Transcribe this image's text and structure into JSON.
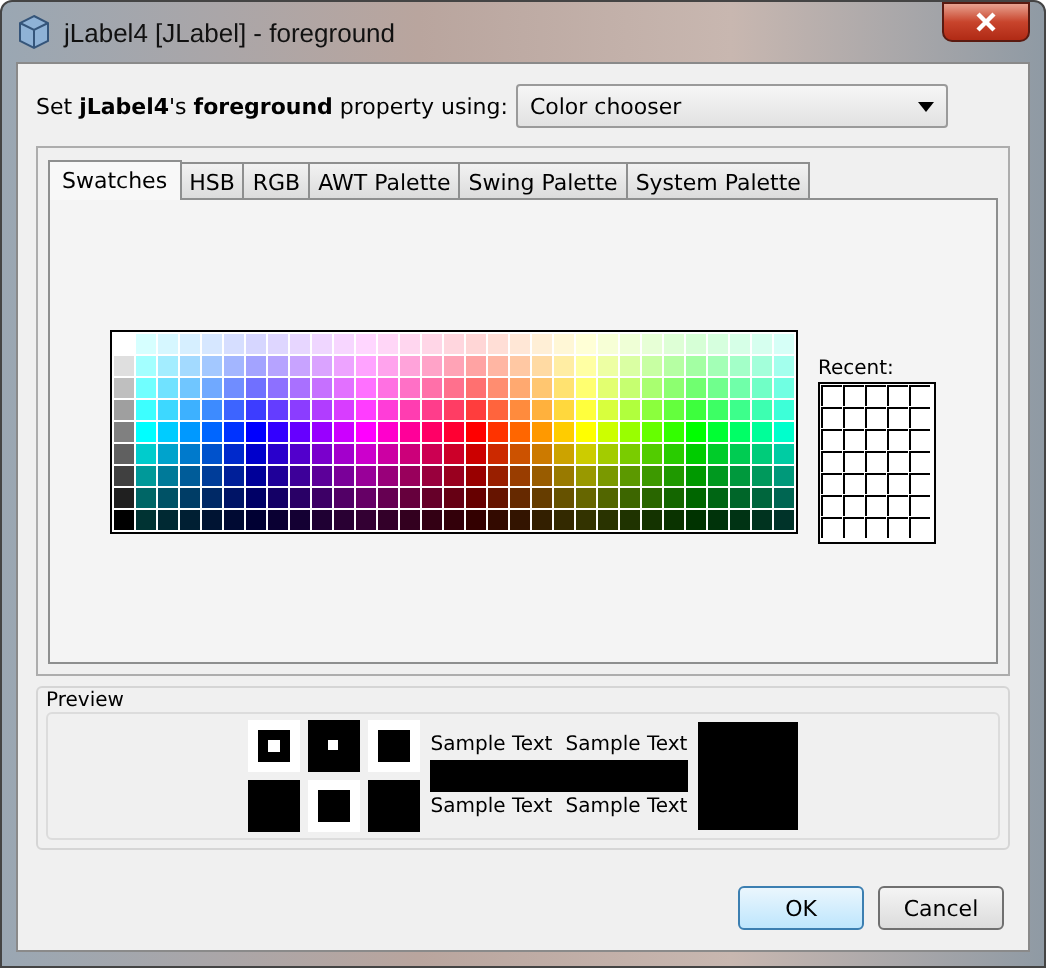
{
  "window": {
    "title": "jLabel4 [JLabel] - foreground"
  },
  "property_prompt": "Set **jLabel4**'s **foreground** property using:",
  "editor_dropdown": {
    "value": "Color chooser"
  },
  "tabs": [
    {
      "label": "Swatches",
      "selected": true
    },
    {
      "label": "HSB",
      "selected": false
    },
    {
      "label": "RGB",
      "selected": false
    },
    {
      "label": "AWT Palette",
      "selected": false
    },
    {
      "label": "Swing Palette",
      "selected": false
    },
    {
      "label": "System Palette",
      "selected": false
    }
  ],
  "recent_label": "Recent:",
  "preview": {
    "title": "Preview",
    "sample_texts": [
      "Sample Text",
      "Sample Text",
      "Sample Text",
      "Sample Text"
    ]
  },
  "buttons": [
    {
      "label": "OK",
      "default": true
    },
    {
      "label": "Cancel",
      "default": false
    }
  ]
}
